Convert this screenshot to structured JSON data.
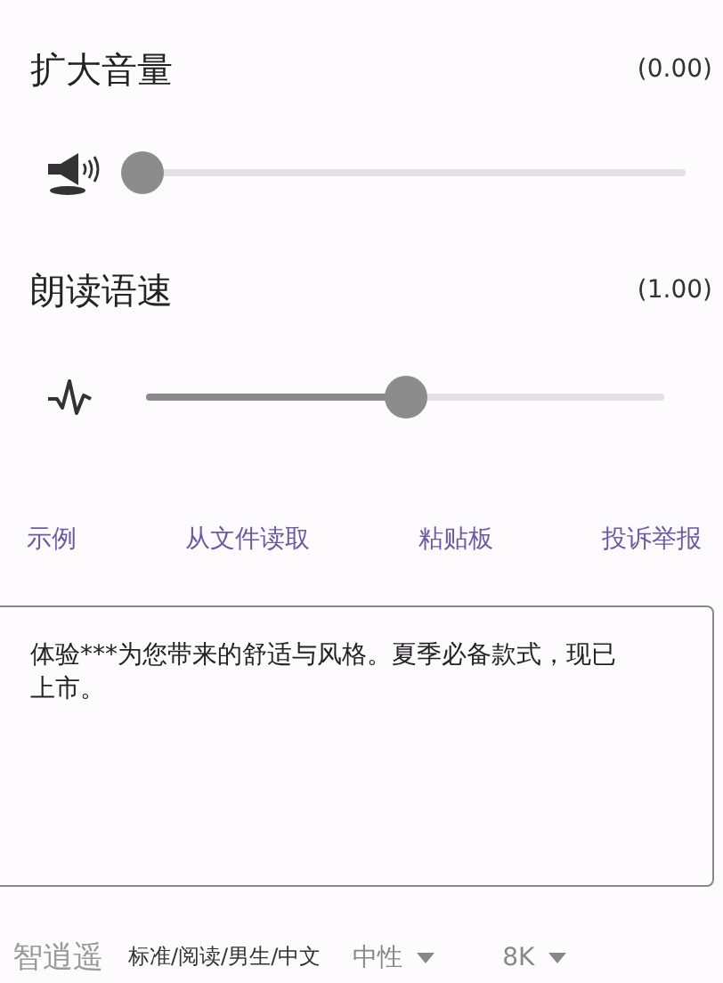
{
  "settings": [
    {
      "kind": "volume",
      "title": "扩大音量",
      "reading": "(0.00)",
      "level": 0.0
    },
    {
      "kind": "speed",
      "title": "朗读语速",
      "reading": "(1.00)",
      "level": 0.5
    }
  ],
  "links": [
    "示例",
    "从文件读取",
    "粘贴板",
    "投诉举报"
  ],
  "text_area": {
    "value": "体验***为您带来的舒适与风格。夏季必备款式，现已上市。"
  },
  "footer": {
    "voice": "智逍遥",
    "style": "标准/阅读/男生/中文",
    "dropdowns": [
      "中性",
      "8K"
    ]
  }
}
